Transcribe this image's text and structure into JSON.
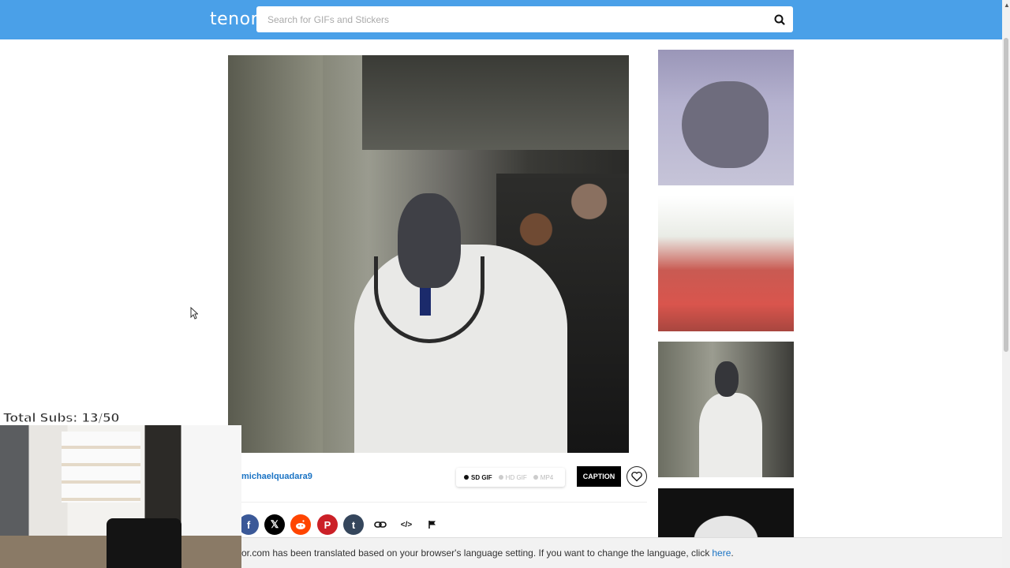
{
  "header": {
    "logo": "tenor",
    "search_placeholder": "Search for GIFs and Stickers"
  },
  "gif": {
    "author": "michaelquadara9",
    "formats": [
      {
        "label": "SD GIF",
        "active": true
      },
      {
        "label": "HD GIF",
        "active": false
      },
      {
        "label": "MP4",
        "active": false
      }
    ],
    "caption_label": "CAPTION"
  },
  "share_icons": [
    "facebook-icon",
    "x-icon",
    "reddit-icon",
    "pinterest-icon",
    "tumblr-icon",
    "link-icon",
    "embed-icon",
    "flag-icon"
  ],
  "overlay": {
    "subs_text": "Total Subs: 13/50"
  },
  "banner": {
    "text": "or.com has been translated based on your browser's language setting. If you want to change the language, click",
    "link": "here",
    "trail": "."
  },
  "colors": {
    "header": "#4aa0e8",
    "facebook": "#3b5998",
    "x": "#000000",
    "reddit": "#ff4500",
    "pinterest": "#cb2027",
    "tumblr": "#35465c",
    "link": "#1a73c4"
  }
}
